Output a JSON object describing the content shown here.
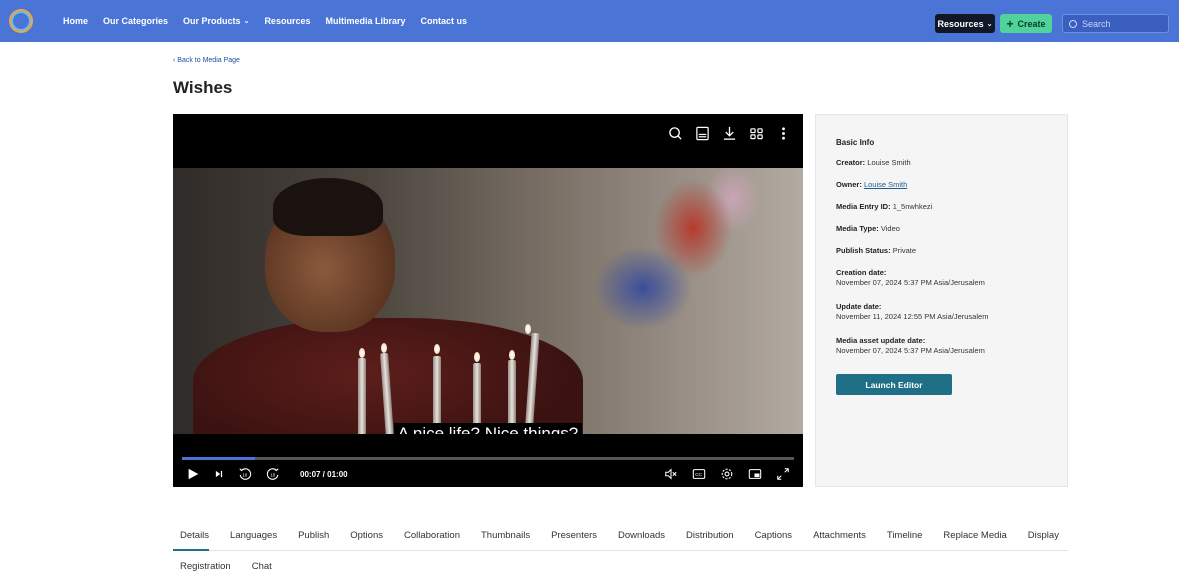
{
  "nav": {
    "links": [
      "Home",
      "Our Categories",
      "Our Products",
      "Resources",
      "Multimedia Library",
      "Contact us"
    ],
    "resources_button": "Resources",
    "create_button": "Create",
    "search_placeholder": "Search"
  },
  "page": {
    "back_link": "Back to Media Page",
    "title": "Wishes"
  },
  "player": {
    "subtitle": "A nice life? Nice things?",
    "time": "00:07 / 01:00",
    "progress": 0.12
  },
  "info": {
    "heading": "Basic Info",
    "creator_label": "Creator:",
    "creator": "Louise Smith",
    "owner_label": "Owner:",
    "owner": "Louise Smith",
    "entry_id_label": "Media Entry ID:",
    "entry_id": "1_5nwhkezi",
    "type_label": "Media Type:",
    "type": "Video",
    "status_label": "Publish Status:",
    "status": "Private",
    "creation_label": "Creation date:",
    "creation": "November 07, 2024 5:37 PM Asia/Jerusalem",
    "update_label": "Update date:",
    "update": "November 11, 2024 12:55 PM Asia/Jerusalem",
    "asset_update_label": "Media asset update date:",
    "asset_update": "November 07, 2024 5:37 PM Asia/Jerusalem",
    "launch_editor": "Launch Editor"
  },
  "tabs": [
    "Details",
    "Languages",
    "Publish",
    "Options",
    "Collaboration",
    "Thumbnails",
    "Presenters",
    "Downloads",
    "Distribution",
    "Captions",
    "Attachments",
    "Timeline",
    "Replace Media",
    "Display"
  ],
  "tabs_row2": [
    "Registration",
    "Chat"
  ],
  "colors": {
    "nav_bg": "#4a74d6",
    "create_bg": "#4fd39a",
    "accent": "#1f6f86"
  }
}
